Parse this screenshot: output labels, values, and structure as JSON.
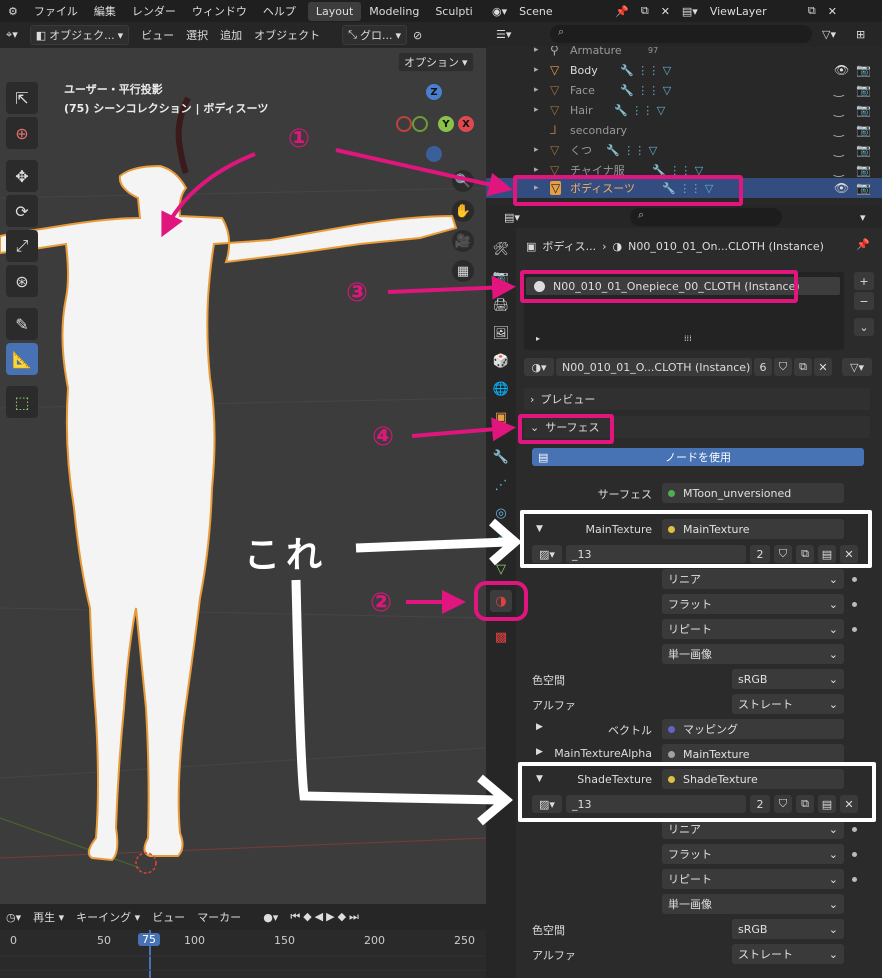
{
  "topbar": {
    "menus": [
      "ファイル",
      "編集",
      "レンダー",
      "ウィンドウ",
      "ヘルプ"
    ],
    "workspaces": [
      "Layout",
      "Modeling",
      "Sculpti"
    ],
    "active_workspace": "Layout",
    "scene": "Scene",
    "view_layer": "ViewLayer"
  },
  "viewport_header": {
    "mode": "オブジェク...",
    "menus": [
      "ビュー",
      "選択",
      "追加",
      "オブジェクト"
    ],
    "transform_orientation": "グロ...",
    "options": "オプション"
  },
  "viewport": {
    "title": "ユーザー・平行投影",
    "subtitle": "(75) シーンコレクション | ボディスーツ",
    "gizmo": {
      "z": "Z",
      "x": "X",
      "y": "Y"
    }
  },
  "timeline": {
    "menus": [
      "再生",
      "キーイング",
      "ビュー",
      "マーカー"
    ],
    "ticks": [
      "0",
      "50",
      "75",
      "100",
      "150",
      "200",
      "250"
    ],
    "current_frame": "75"
  },
  "outliner": {
    "rows": [
      {
        "name": "Armature",
        "icon": "armature-icon",
        "extra": "97"
      },
      {
        "name": "Body",
        "icon": "mesh-icon"
      },
      {
        "name": "Face",
        "icon": "mesh-icon"
      },
      {
        "name": "Hair",
        "icon": "mesh-icon"
      },
      {
        "name": "secondary",
        "icon": "empty-icon"
      },
      {
        "name": "くつ",
        "icon": "mesh-icon"
      },
      {
        "name": "チャイナ服",
        "icon": "mesh-icon"
      },
      {
        "name": "ボディスーツ",
        "icon": "mesh-icon",
        "selected": true
      }
    ]
  },
  "properties": {
    "breadcrumb_object": "ボディス...",
    "breadcrumb_material": "N00_010_01_On...CLOTH (Instance)",
    "slot_name": "N00_010_01_Onepiece_00_CLOTH (Instance)",
    "material_name": "N00_010_01_O...CLOTH (Instance)",
    "material_users": "6",
    "preview_label": "プレビュー",
    "surface_panel": "サーフェス",
    "use_nodes": "ノードを使用",
    "surface_label": "サーフェス",
    "surface_value": "MToon_unversioned",
    "main_texture_label": "MainTexture",
    "main_texture_value": "MainTexture",
    "image_name": "_13",
    "image_users": "2",
    "interp": "リニア",
    "projection": "フラット",
    "extension": "リピート",
    "source": "単一画像",
    "colorspace_label": "色空間",
    "colorspace_value": "sRGB",
    "alpha_label": "アルファ",
    "alpha_value": "ストレート",
    "vector_label": "ベクトル",
    "vector_value": "マッピング",
    "alpha_tex_label": "MainTextureAlpha",
    "alpha_tex_value": "MainTexture",
    "shade_texture_label": "ShadeTexture",
    "shade_texture_value": "ShadeTexture",
    "image_name2": "_13",
    "image_users2": "2",
    "interp2": "リニア",
    "projection2": "フラット",
    "extension2": "リピート",
    "source2": "単一画像",
    "colorspace_label2": "色空間",
    "colorspace_value2": "sRGB",
    "alpha_label2": "アルファ",
    "alpha_value2": "ストレート"
  },
  "annotations": {
    "n1": "①",
    "n2": "②",
    "n3": "③",
    "n4": "④",
    "kore": "これ",
    "pink": "#e0157e"
  }
}
